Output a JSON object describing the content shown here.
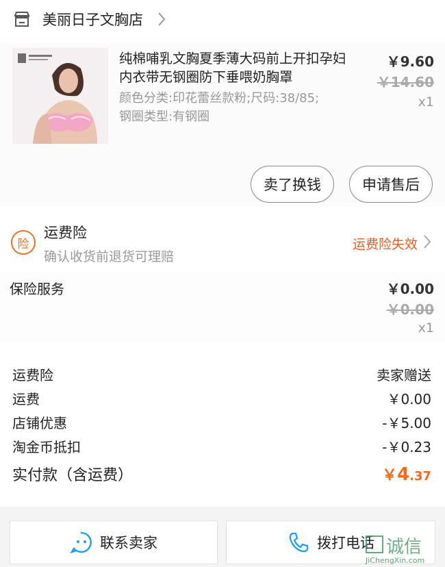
{
  "shop": {
    "name": "美丽日子文胸店"
  },
  "product": {
    "title": "纯棉哺乳文胸夏季薄大码前上开扣孕妇内衣带无钢圈防下垂喂奶胸罩",
    "sku": "颜色分类:印花蕾丝款粉;尺码:38/85;钢圈类型:有钢圈",
    "price": "￥9.60",
    "original_price": "￥14.60",
    "quantity": "x1"
  },
  "actions": {
    "sell_label": "卖了换钱",
    "after_sale_label": "申请售后"
  },
  "insurance": {
    "badge": "险",
    "name": "运费险",
    "desc": "确认收货前退货可理赔",
    "status": "运费险失效"
  },
  "service": {
    "name": "保险服务",
    "price": "￥0.00",
    "original_price": "￥0.00",
    "quantity": "x1"
  },
  "summary": {
    "rows": [
      {
        "label": "运费险",
        "value": "卖家赠送"
      },
      {
        "label": "运费",
        "value": "￥0.00"
      },
      {
        "label": "店铺优惠",
        "value": "-￥5.00"
      },
      {
        "label": "淘金币抵扣",
        "value": "-￥0.23"
      }
    ],
    "total_label": "实付款（含运费）",
    "total_symbol": "￥",
    "total_int": "4",
    "total_dec": ".37"
  },
  "bottom": {
    "contact_label": "联系卖家",
    "call_label": "拨打电话"
  },
  "watermark": {
    "text": "诚信",
    "url": "JiChengXin.com"
  },
  "colors": {
    "accent": "#f26a1e",
    "status": "#f05a1a",
    "icon_blue": "#1ea0f0"
  }
}
